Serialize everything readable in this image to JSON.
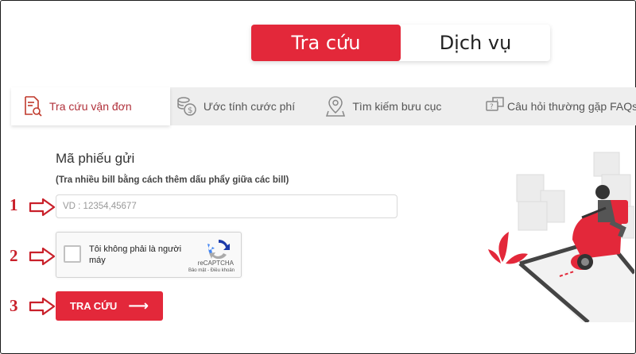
{
  "top_tabs": [
    {
      "label": "Tra cứu"
    },
    {
      "label": "Dịch vụ"
    }
  ],
  "tabs": [
    {
      "label": "Tra cứu vận đơn",
      "icon": "document-search-icon"
    },
    {
      "label": "Ước tính cước phí",
      "icon": "coins-icon"
    },
    {
      "label": "Tìm kiếm bưu cục",
      "icon": "map-pin-icon"
    },
    {
      "label": "Câu hỏi thường gặp FAQs",
      "icon": "question-chat-icon"
    }
  ],
  "form": {
    "title": "Mã phiếu gửi",
    "hint": "(Tra nhiều bill bằng cách thêm dấu phẩy giữa các bill)",
    "placeholder": "VD : 12354,45677",
    "captcha_label": "Tôi không phải là người máy",
    "captcha_brand": "reCAPTCHA",
    "captcha_links": "Bảo mật - Điều khoản",
    "submit_label": "TRA CỨU",
    "submit_arrow": "⟶"
  },
  "steps": [
    "1",
    "2",
    "3"
  ],
  "colors": {
    "accent": "#e3283a",
    "step": "#c9202a"
  }
}
